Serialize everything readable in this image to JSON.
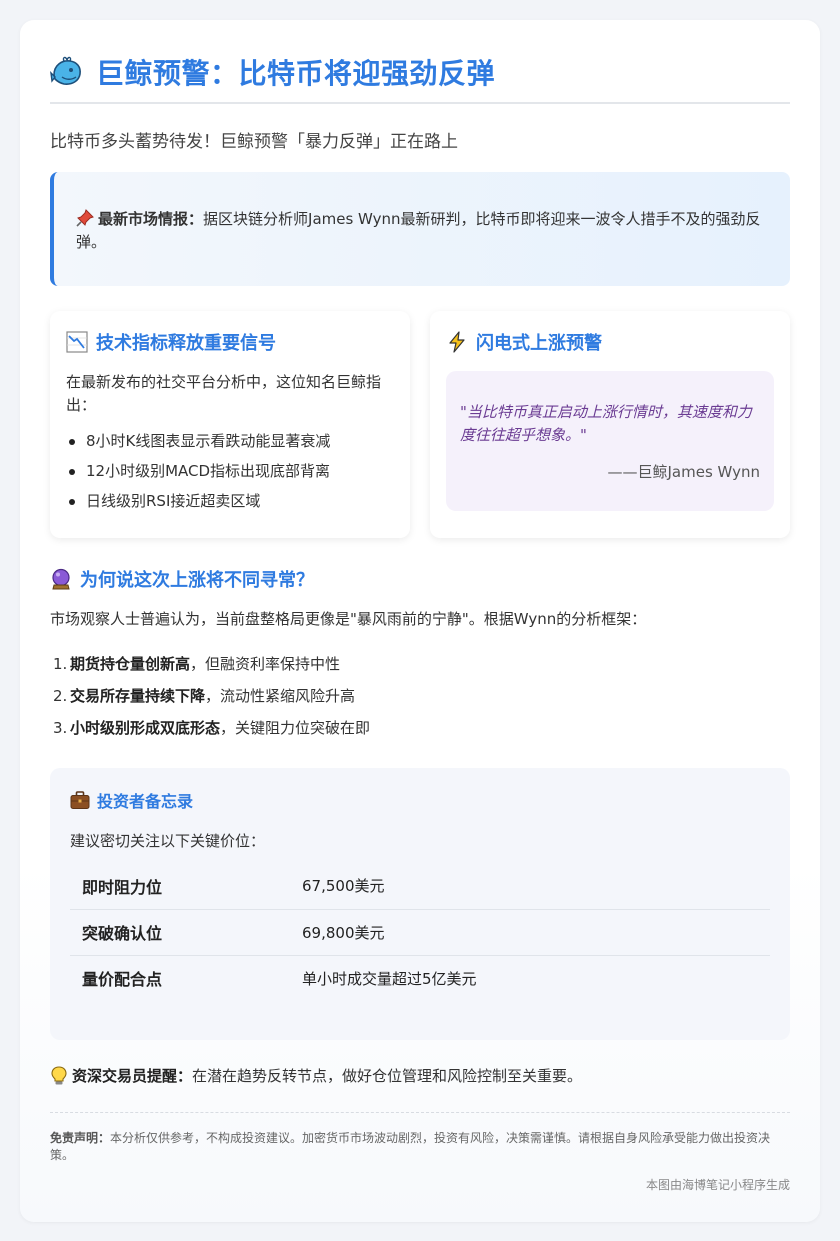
{
  "header": {
    "title": "巨鲸预警：比特币将迎强劲反弹",
    "icon": "whale-icon"
  },
  "subtitle": "比特币多头蓄势待发！巨鲸预警「暴力反弹」正在路上",
  "intel": {
    "icon": "pushpin-icon",
    "label": "最新市场情报：",
    "text": "据区块链分析师James Wynn最新研判，比特币即将迎来一波令人措手不及的强劲反弹。",
    "accent": "#2f7be0"
  },
  "signals": {
    "icon": "chart-decreasing-icon",
    "heading": "技术指标释放重要信号",
    "intro": "在最新发布的社交平台分析中，这位知名巨鲸指出：",
    "items": [
      "8小时K线图表显示看跌动能显著衰减",
      "12小时级别MACD指标出现底部背离",
      "日线级别RSI接近超卖区域"
    ]
  },
  "warning": {
    "icon": "lightning-icon",
    "heading": "闪电式上涨预警",
    "quote": "\"当比特币真正启动上涨行情时，其速度和力度往往超乎想象。\"",
    "author": "——巨鲸James Wynn"
  },
  "why": {
    "icon": "crystal-ball-icon",
    "heading": "为何说这次上涨将不同寻常？",
    "text": "市场观察人士普遍认为，当前盘整格局更像是\"暴风雨前的宁静\"。根据Wynn的分析框架：",
    "items": [
      {
        "num": "1.",
        "bold": "期货持仓量创新高",
        "rest": "，但融资利率保持中性"
      },
      {
        "num": "2.",
        "bold": "交易所存量持续下降",
        "rest": "，流动性紧缩风险升高"
      },
      {
        "num": "3.",
        "bold": "小时级别形成双底形态",
        "rest": "，关键阻力位突破在即"
      }
    ]
  },
  "memo": {
    "icon": "briefcase-icon",
    "heading": "投资者备忘录",
    "text": "建议密切关注以下关键价位：",
    "rows": [
      {
        "key": "即时阻力位",
        "value": "67,500美元"
      },
      {
        "key": "突破确认位",
        "value": "69,800美元"
      },
      {
        "key": "量价配合点",
        "value": "单小时成交量超过5亿美元"
      }
    ]
  },
  "tip": {
    "icon": "lightbulb-icon",
    "label": "资深交易员提醒：",
    "text": "在潜在趋势反转节点，做好仓位管理和风险控制至关重要。"
  },
  "disclaimer": {
    "label": "免责声明：",
    "text": "本分析仅供参考，不构成投资建议。加密货币市场波动剧烈，投资有风险，决策需谨慎。请根据自身风险承受能力做出投资决策。"
  },
  "footer": "本图由海博笔记小程序生成"
}
